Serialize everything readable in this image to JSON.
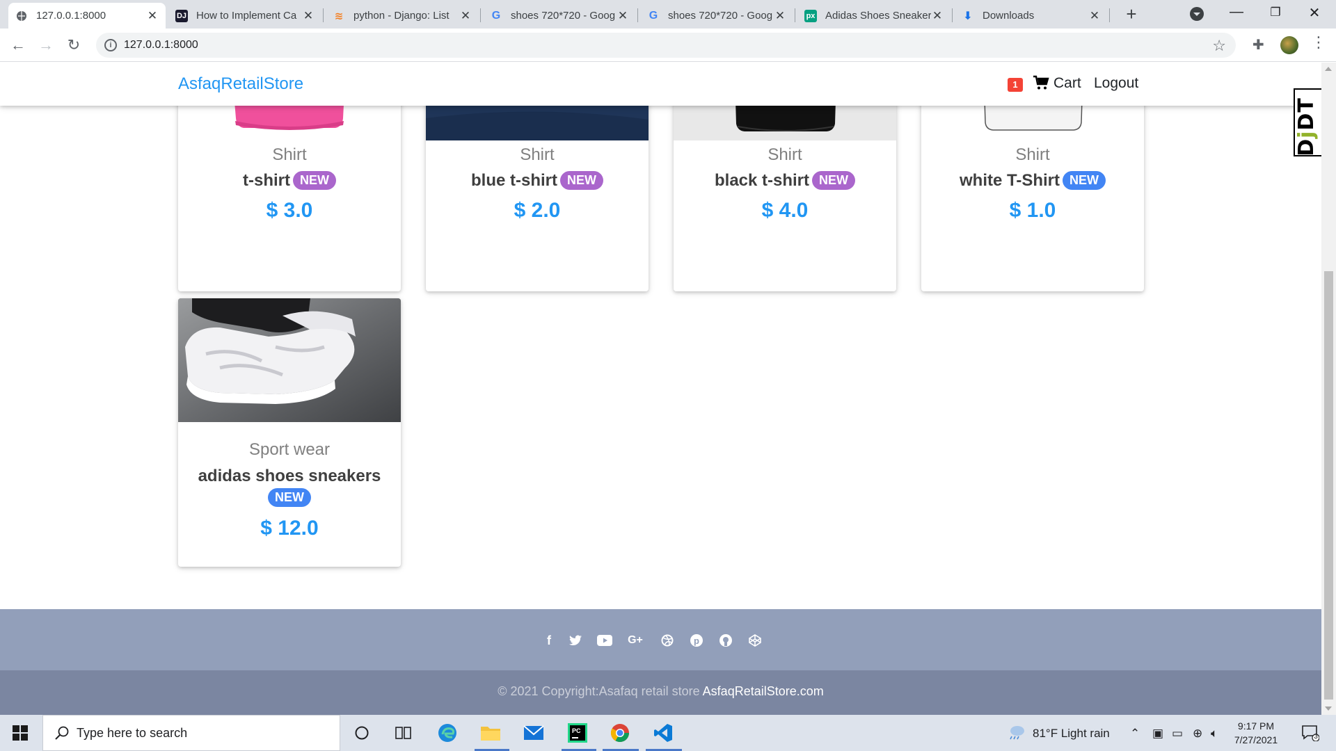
{
  "browser": {
    "tabs": [
      {
        "title": "127.0.0.1:8000",
        "active": true
      },
      {
        "title": "How to Implement Ca",
        "active": false
      },
      {
        "title": "python - Django: List",
        "active": false
      },
      {
        "title": "shoes 720*720 - Goog",
        "active": false
      },
      {
        "title": "shoes 720*720 - Goog",
        "active": false
      },
      {
        "title": "Adidas Shoes Sneaker",
        "active": false
      },
      {
        "title": "Downloads",
        "active": false
      }
    ],
    "url": "127.0.0.1:8000"
  },
  "site": {
    "brand": "AsfaqRetailStore",
    "cart_count": "1",
    "cart_label": "Cart",
    "logout_label": "Logout",
    "debug_toolbar": "DjDT"
  },
  "products": [
    {
      "category": "Shirt",
      "name": "t-shirt",
      "badge": "NEW",
      "badge_color": "#aa66cc",
      "price": "$ 3.0"
    },
    {
      "category": "Shirt",
      "name": "blue t-shirt",
      "badge": "NEW",
      "badge_color": "#aa66cc",
      "price": "$ 2.0"
    },
    {
      "category": "Shirt",
      "name": "black t-shirt",
      "badge": "NEW",
      "badge_color": "#aa66cc",
      "price": "$ 4.0"
    },
    {
      "category": "Shirt",
      "name": "white T-Shirt",
      "badge": "NEW",
      "badge_color": "#4285f4",
      "price": "$ 1.0"
    },
    {
      "category": "Sport wear",
      "name": "adidas shoes sneakers",
      "badge": "NEW",
      "badge_color": "#4285f4",
      "price": "$ 12.0"
    }
  ],
  "footer": {
    "social": [
      "facebook-icon",
      "twitter-icon",
      "youtube-icon",
      "google-plus-icon",
      "dribbble-icon",
      "pinterest-icon",
      "github-icon",
      "codepen-icon"
    ],
    "copyright": "© 2021 Copyright:Asafaq retail store",
    "site_link": "AsfaqRetailStore.com"
  },
  "taskbar": {
    "search_placeholder": "Type here to search",
    "weather": "81°F  Light rain",
    "time": "9:17 PM",
    "date": "7/27/2021",
    "notification_count": "3"
  },
  "colors": {
    "brand": "#2196f3",
    "price": "#2196f3",
    "footer_top": "#929fba",
    "footer_bottom": "#7b86a1"
  }
}
